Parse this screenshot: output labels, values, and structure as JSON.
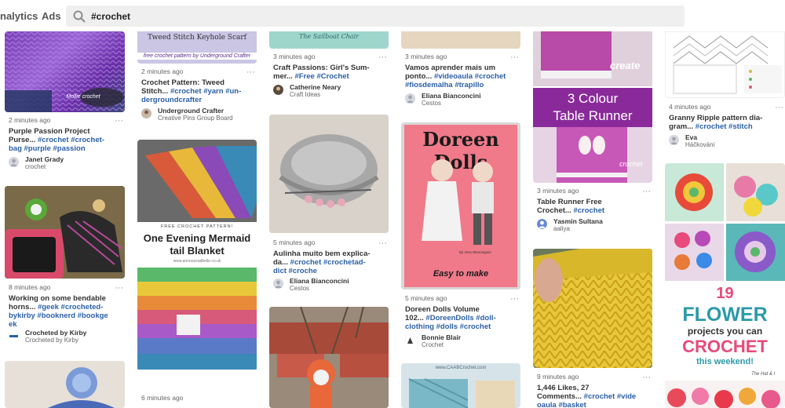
{
  "nav": {
    "analytics": "nalytics",
    "ads": "Ads"
  },
  "search": {
    "value": "#crochet"
  },
  "pins": {
    "p1": {
      "time": "2 minutes ago",
      "title_1": "Purple Passion Project",
      "title_2a": "Purse... ",
      "title_2b": "#crochet #crochet-",
      "title_3": "bag #purple #passion",
      "user": "Janet Grady",
      "board": "crochet",
      "img_caption": "Mollie crochet"
    },
    "p2": {
      "time": "8 minutes ago",
      "title_1": "Working on some bendable",
      "title_2a": "horns... ",
      "title_2b": "#geek #crocheted-",
      "title_3": "bykirby #booknerd #bookge",
      "title_4": "ek",
      "user": "Crocheted by Kirby",
      "board": "Crocheted by Kirby"
    },
    "p3": {
      "img_title": "Tweed Stitch Keyhole Scarf",
      "img_sub": "free crochet pattern by Underground Crafter",
      "time": "2 minutes ago",
      "title_1": "Crochet Pattern: Tweed",
      "title_2a": "Stitch... ",
      "title_2b": "#crochet #yarn #un-",
      "title_3": "dergroundcrafter",
      "user": "Underground Crafter",
      "board": "Creative Pins Group Board"
    },
    "p4": {
      "img_banner": "FREE CROCHET PATTERN!",
      "img_title_1": "One Evening Mermaid",
      "img_title_2": "tail Blanket",
      "img_url": "www.annoozeadbelle.co.uk",
      "time": "6 minutes ago"
    },
    "p5": {
      "img_title": "The Sailboat Chair",
      "time": "3 minutes ago",
      "title_1": "Craft Passions: Girl's Sum-",
      "title_2a": "mer... ",
      "title_2b": "#Free #Crochet",
      "user": "Catherine Neary",
      "board": "Craft Ideas"
    },
    "p6": {
      "time": "5 minutes ago",
      "title_1": "Aulinha muito bem explica-",
      "title_2a": "da... ",
      "title_2b": "#crochet #crochetad-",
      "title_3": "dict #croche",
      "user": "Eliana Bianconcini",
      "board": "Cestos"
    },
    "p7": {
      "time": "3 minutes ago",
      "title_1": "Vamos aprender mais um",
      "title_2a": "ponto... ",
      "title_2b": "#videoaula #crochet",
      "title_3": "#fiosdemalha #trapillo",
      "user": "Eliana Bianconcini",
      "board": "Cestos"
    },
    "p8": {
      "img_title": "Doreen Dolls",
      "img_small": "By Vera Wannington",
      "img_bottom": "Easy to make",
      "time": "5 minutes ago",
      "title_1": "Doreen Dolls Volume",
      "title_2a": "102... ",
      "title_2b": "#DoreenDolls #doll-",
      "title_3": "clothing #dolls #crochet",
      "user": "Bonnie Blair",
      "board": "Crochet"
    },
    "p9": {
      "img_site": "www.CAABCrochet.com"
    },
    "p10": {
      "img_word": "create",
      "img_title_1": "3 Colour",
      "img_title_2": "Table Runner",
      "img_logo": "crochet",
      "time": "3 minutes ago",
      "title_1": "Table Runner Free",
      "title_2a": "Crochet... ",
      "title_2b": "#crochet",
      "user": "Yasmin Sultana",
      "board": "aaliya"
    },
    "p11": {
      "time": "9 minutes ago",
      "title_1": "1,446 Likes, 27",
      "title_2a": "Comments... ",
      "title_2b": "#crochet #vide",
      "title_3": "oaula #basket"
    },
    "p12": {
      "time": "4 minutes ago",
      "title_1": "Granny Ripple pattern dia-",
      "title_2a": "gram... ",
      "title_2b": "#crochet #stitch",
      "user": "Eva",
      "board": "Háčkování"
    },
    "p13": {
      "img_num": "19",
      "img_l1": "FLOWER",
      "img_l2": "projects you can",
      "img_l3": "CROCHET",
      "img_l4": "this weekend!",
      "img_tag": "The Hat & I"
    }
  },
  "dots": "···",
  "colors": {
    "link": "#2a5fa8",
    "purple": "#8a2a9a",
    "pink_cover": "#f07a8a"
  }
}
